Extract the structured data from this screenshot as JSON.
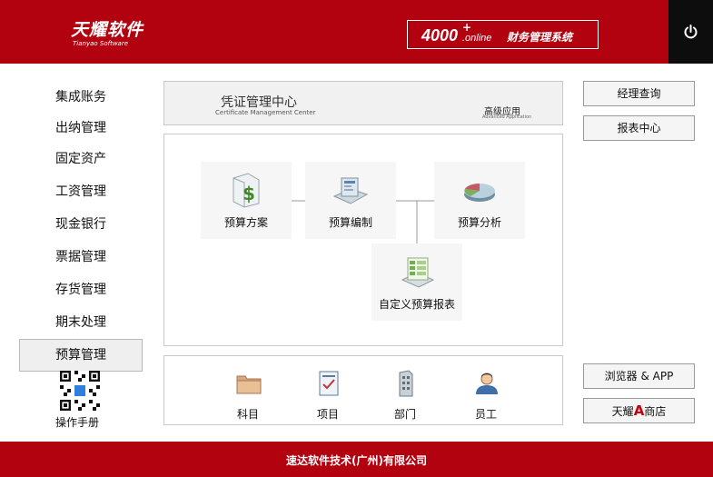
{
  "header": {
    "logo_cn": "天耀软件",
    "logo_en": "Tianyao Software",
    "system_brand": "4000",
    "system_plus": "+",
    "system_online": ".online",
    "system_name": "财务管理系统"
  },
  "sidebar": {
    "items": [
      {
        "label": "集成账务"
      },
      {
        "label": "出纳管理"
      },
      {
        "label": "固定资产"
      },
      {
        "label": "工资管理"
      },
      {
        "label": "现金银行"
      },
      {
        "label": "票据管理"
      },
      {
        "label": "存货管理"
      },
      {
        "label": "期末处理"
      },
      {
        "label": "预算管理",
        "active": true
      }
    ],
    "manual_link": "操作手册"
  },
  "top_panel": {
    "title": "凭证管理中心",
    "subtitle": "Certificate Management Center",
    "advanced_title": "高级应用",
    "advanced_sub": "Advanced Application"
  },
  "flow": {
    "budget_plan": "预算方案",
    "budget_edit": "预算编制",
    "budget_analysis": "预算分析",
    "custom_report": "自定义预算报表"
  },
  "bottom": {
    "account": "科目",
    "project": "项目",
    "department": "部门",
    "employee": "员工"
  },
  "right": {
    "manager_query": "经理查询",
    "report_center": "报表中心",
    "browser_app": "浏览器 & APP",
    "store_prefix": "天耀",
    "store_mark": "A",
    "store_suffix": "商店"
  },
  "footer": {
    "company": "速达软件技术(广州)有限公司"
  },
  "colors": {
    "brand_red": "#b3020f",
    "power_bg": "#0d0d0d"
  }
}
